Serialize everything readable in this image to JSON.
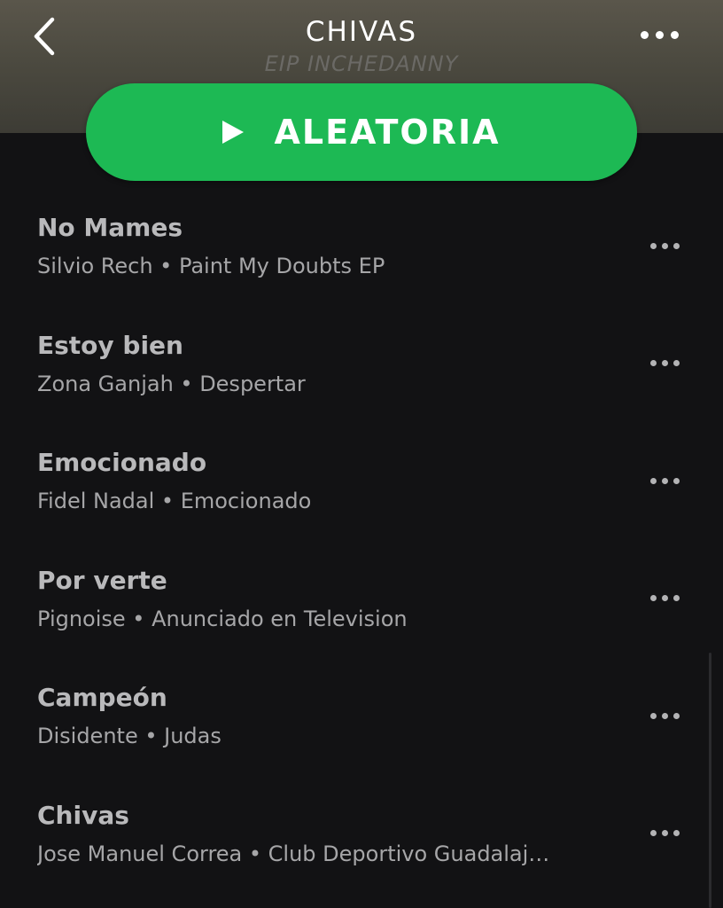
{
  "header": {
    "title": "CHIVAS",
    "watermark": "EIP INCHEDANNY",
    "back_icon": "chevron-left-icon",
    "more_icon": "more-horizontal-icon",
    "background_color": "#4c4a40"
  },
  "shuffle": {
    "label": "ALEATORIA",
    "icon": "play-icon",
    "color": "#1db954"
  },
  "tracks": [
    {
      "title": "No Mames",
      "subtitle": "Silvio Rech • Paint My Doubts EP"
    },
    {
      "title": "Estoy bien",
      "subtitle": "Zona Ganjah • Despertar"
    },
    {
      "title": "Emocionado",
      "subtitle": "Fidel Nadal • Emocionado"
    },
    {
      "title": "Por verte",
      "subtitle": "Pignoise • Anunciado en Television"
    },
    {
      "title": "Campeón",
      "subtitle": "Disidente • Judas"
    },
    {
      "title": "Chivas",
      "subtitle": "Jose Manuel Correa • Club Deportivo Guadalaj…"
    }
  ],
  "colors": {
    "background": "#121214",
    "track_title": "#b9b9bb",
    "track_subtitle": "#a6a6a8"
  }
}
